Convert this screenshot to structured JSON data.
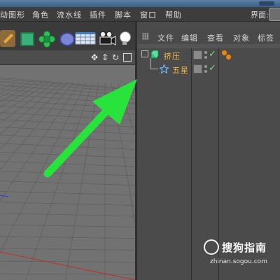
{
  "menubar": {
    "items": [
      "动图形",
      "角色",
      "流水线",
      "插件",
      "脚本",
      "窗口",
      "帮助"
    ],
    "layout_label": "界面:"
  },
  "toolbar": {
    "tools": [
      "pen-icon",
      "cube-icon",
      "generator-icon",
      "deformer-icon",
      "floor-icon",
      "camera-icon",
      "light-icon"
    ]
  },
  "viewport": {
    "nav_icons": [
      "move-icon",
      "zoom-icon",
      "rotate-icon",
      "layout-toggle-icon"
    ],
    "grid_color": "#5f5f5f",
    "axis_x_color": "#c0302a",
    "axis_z_color": "#3a46c8"
  },
  "object_manager": {
    "menu": [
      "文件",
      "编辑",
      "查看",
      "对象",
      "标签"
    ],
    "objects": [
      {
        "name": "挤压",
        "icon": "extrude-icon",
        "visible_check": "✓"
      },
      {
        "name": "五星",
        "icon": "star-spline-icon",
        "visible_check": "✓"
      }
    ]
  },
  "annotation": {
    "arrow_color": "#27e33c"
  },
  "watermark": {
    "text": "搜狗指南",
    "domain": "zhinan.sogou.com"
  }
}
